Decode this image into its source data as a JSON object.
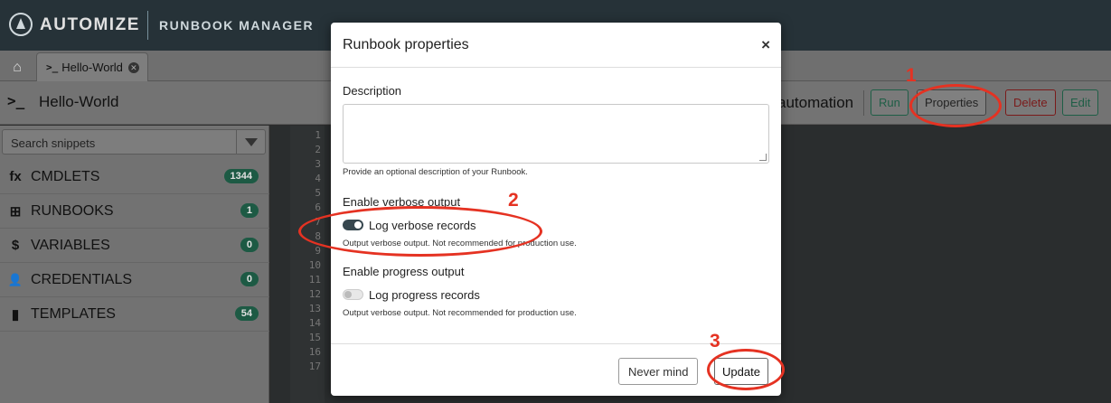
{
  "topbar": {
    "brand": "AUTOMIZE",
    "app_title": "RUNBOOK MANAGER"
  },
  "tabs": {
    "home_icon": "home-icon",
    "active_tab": {
      "prompt": ">_",
      "label": "Hello-World",
      "close_icon": "close-circle-icon"
    }
  },
  "header": {
    "prompt": ">_",
    "runbook_name": "Hello-World",
    "automation_label": "automation",
    "buttons": {
      "run": "Run",
      "properties": "Properties",
      "delete": "Delete",
      "edit": "Edit"
    }
  },
  "sidebar": {
    "search_placeholder": "Search snippets",
    "items": [
      {
        "icon": "fx",
        "label": "CMDLETS",
        "count": "1344"
      },
      {
        "icon": "⊞",
        "label": "RUNBOOKS",
        "count": "1"
      },
      {
        "icon": "$",
        "label": "VARIABLES",
        "count": "0"
      },
      {
        "icon": "👤",
        "label": "CREDENTIALS",
        "count": "0"
      },
      {
        "icon": "▮",
        "label": "TEMPLATES",
        "count": "54"
      }
    ]
  },
  "editor": {
    "line_numbers": [
      "1",
      "2",
      "3",
      "4",
      "5",
      "6",
      "7",
      "8",
      "9",
      "10",
      "11",
      "12",
      "13",
      "14",
      "15",
      "16",
      "17"
    ]
  },
  "modal": {
    "title": "Runbook properties",
    "close": "×",
    "description_label": "Description",
    "description_value": "",
    "description_help": "Provide an optional description of your Runbook.",
    "verbose": {
      "section_label": "Enable verbose output",
      "toggle_label": "Log verbose records",
      "enabled": true,
      "help": "Output verbose output. Not recommended for production use."
    },
    "progress": {
      "section_label": "Enable progress output",
      "toggle_label": "Log progress records",
      "enabled": false,
      "help": "Output verbose output. Not recommended for production use."
    },
    "buttons": {
      "never_mind": "Never mind",
      "update": "Update"
    }
  },
  "annotations": {
    "step1": "1",
    "step2": "2",
    "step3": "3",
    "color": "#e53222"
  }
}
